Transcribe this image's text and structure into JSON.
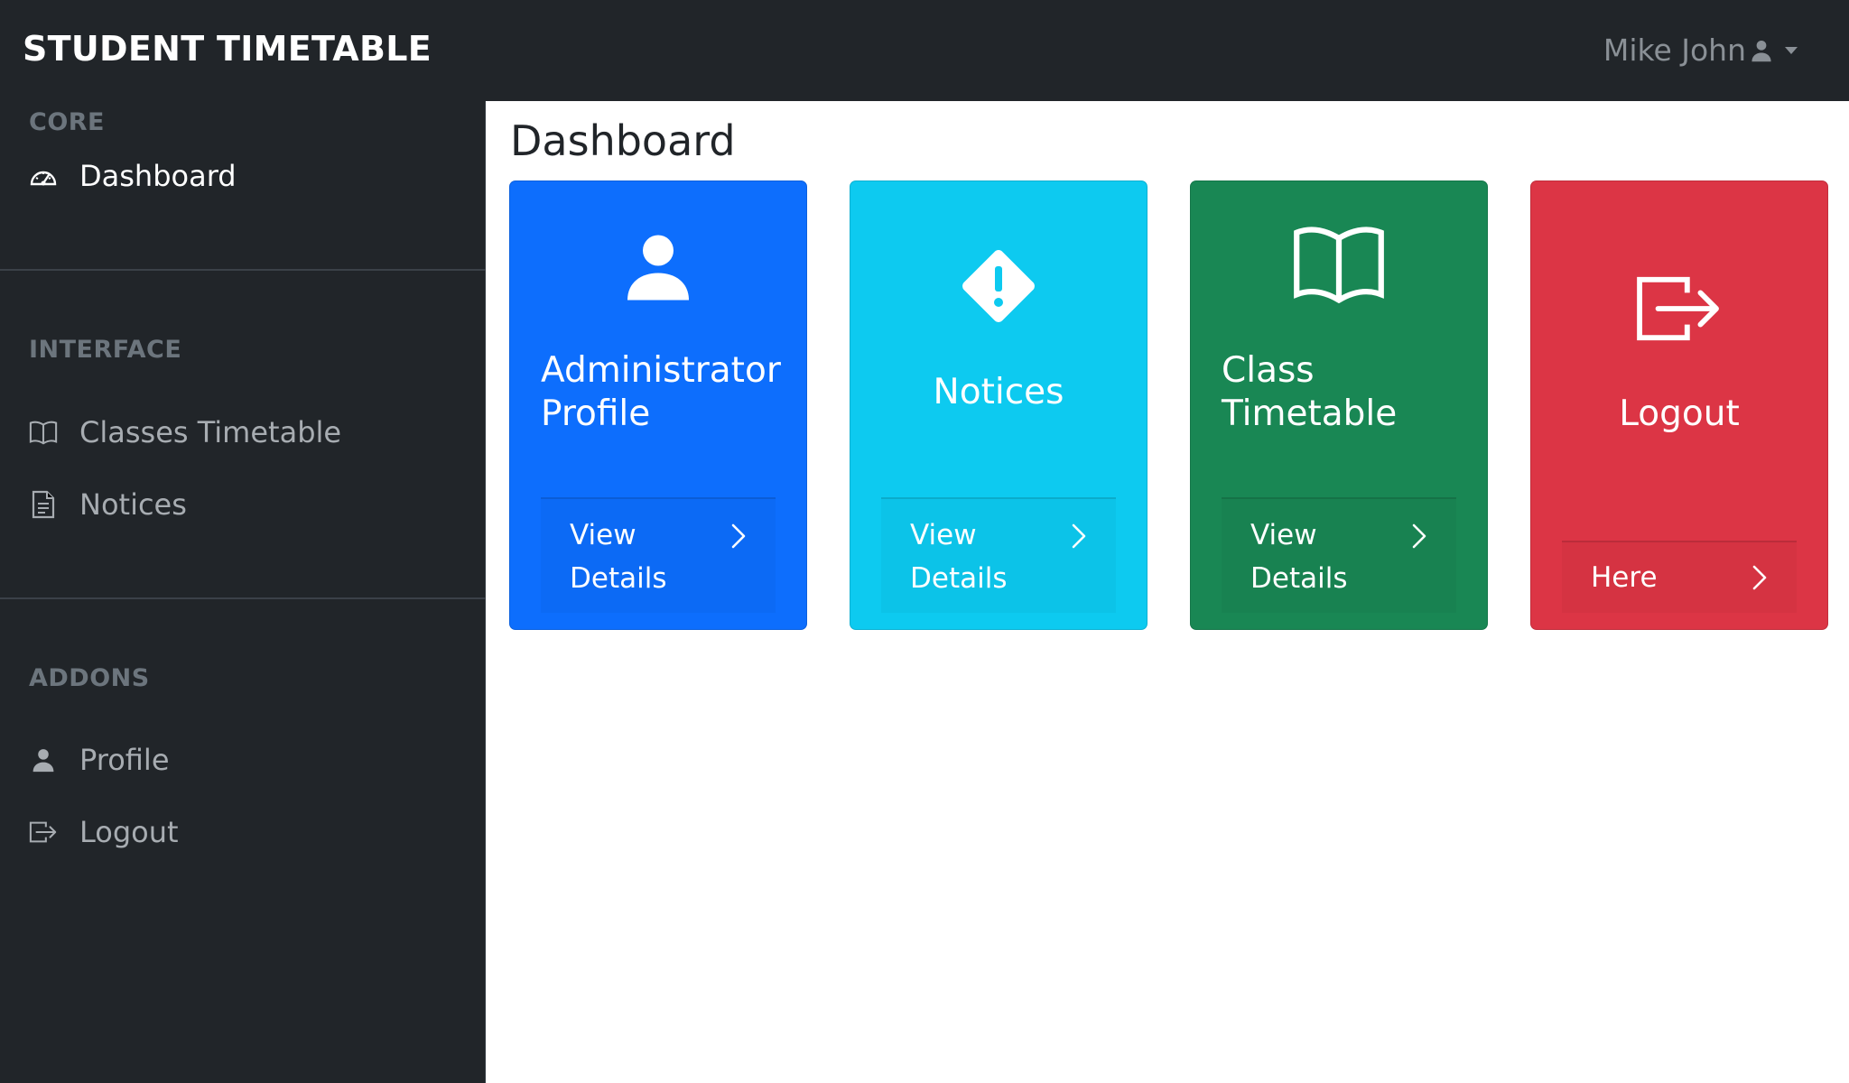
{
  "header": {
    "brand": "STUDENT TIMETABLE",
    "user_name": "Mike John",
    "user_icon": "user-icon",
    "caret_icon": "caret-down-icon"
  },
  "sidebar": {
    "sections": [
      {
        "heading": "CORE",
        "items": [
          {
            "label": "Dashboard",
            "icon": "speedometer-icon",
            "active": true
          }
        ]
      },
      {
        "heading": "INTERFACE",
        "items": [
          {
            "label": "Classes Timetable",
            "icon": "book-icon"
          },
          {
            "label": "Notices",
            "icon": "document-icon"
          }
        ]
      },
      {
        "heading": "ADDONS",
        "items": [
          {
            "label": "Profile",
            "icon": "user-icon"
          },
          {
            "label": "Logout",
            "icon": "logout-icon"
          }
        ]
      }
    ]
  },
  "main": {
    "title": "Dashboard",
    "cards": [
      {
        "title": "Administrator Profile",
        "footer": "View Details",
        "icon": "user-icon",
        "color": "#0d6efd"
      },
      {
        "title": "Notices",
        "footer": "View Details",
        "icon": "warning-diamond-icon",
        "color": "#0dcaf0"
      },
      {
        "title": "Class Timetable",
        "footer": "View Details",
        "icon": "book-icon",
        "color": "#198754"
      },
      {
        "title": "Logout",
        "footer": "Here",
        "icon": "logout-icon",
        "color": "#dc3545"
      }
    ]
  }
}
